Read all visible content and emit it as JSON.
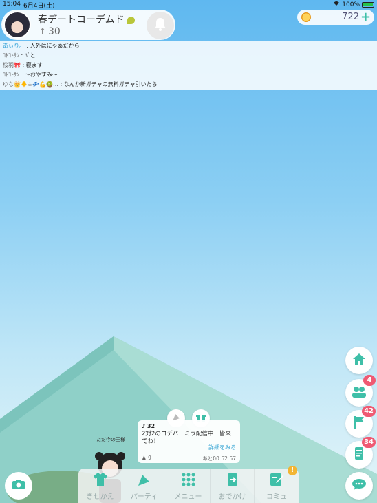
{
  "status_bar": {
    "time": "15:04",
    "date": "6月4日(土)",
    "battery": "100%"
  },
  "profile": {
    "name": "春デートコーデムド",
    "level": "30"
  },
  "currency": {
    "amount": "722",
    "add_label": "+"
  },
  "chat": [
    {
      "user": "あぃり。",
      "message": "人外はにゃぁだから"
    },
    {
      "user": "ｺﾄｺﾄｻﾝ",
      "message": "ﾊﾞと"
    },
    {
      "user": "桜羽🎀",
      "message": "寝ます"
    },
    {
      "user": "ｺﾄｺﾄｻﾝ",
      "message": "〜おやすみ〜"
    },
    {
      "user": "ゆな👑🐥☕💤💪🥝…",
      "message": "なんか新ガチャの無料ガチャ引いたら"
    }
  ],
  "side_buttons": [
    {
      "name": "home",
      "badge": ""
    },
    {
      "name": "friends",
      "badge": "4"
    },
    {
      "name": "events",
      "badge": "42"
    },
    {
      "name": "news",
      "badge": "34"
    },
    {
      "name": "chat",
      "badge": ""
    }
  ],
  "event_card": {
    "count": "32",
    "text": "2対2のコデバ！ミラ配信中！皆来てね！",
    "link": "詳細をみる",
    "participants": "9",
    "time_left": "あと00:52:57"
  },
  "npc": {
    "label": "ただ今の王様"
  },
  "nav": [
    {
      "label": "きせかえ",
      "icon": "shirt-icon"
    },
    {
      "label": "パーティ",
      "icon": "party-popper-icon"
    },
    {
      "label": "メニュー",
      "icon": "grid-icon"
    },
    {
      "label": "おでかけ",
      "icon": "door-exit-icon"
    },
    {
      "label": "コミュ",
      "icon": "notepad-icon",
      "alert": "!"
    }
  ],
  "colors": {
    "accent": "#3fbfa8",
    "badge": "#ef5a73",
    "sky_top": "#5fb8f0"
  }
}
